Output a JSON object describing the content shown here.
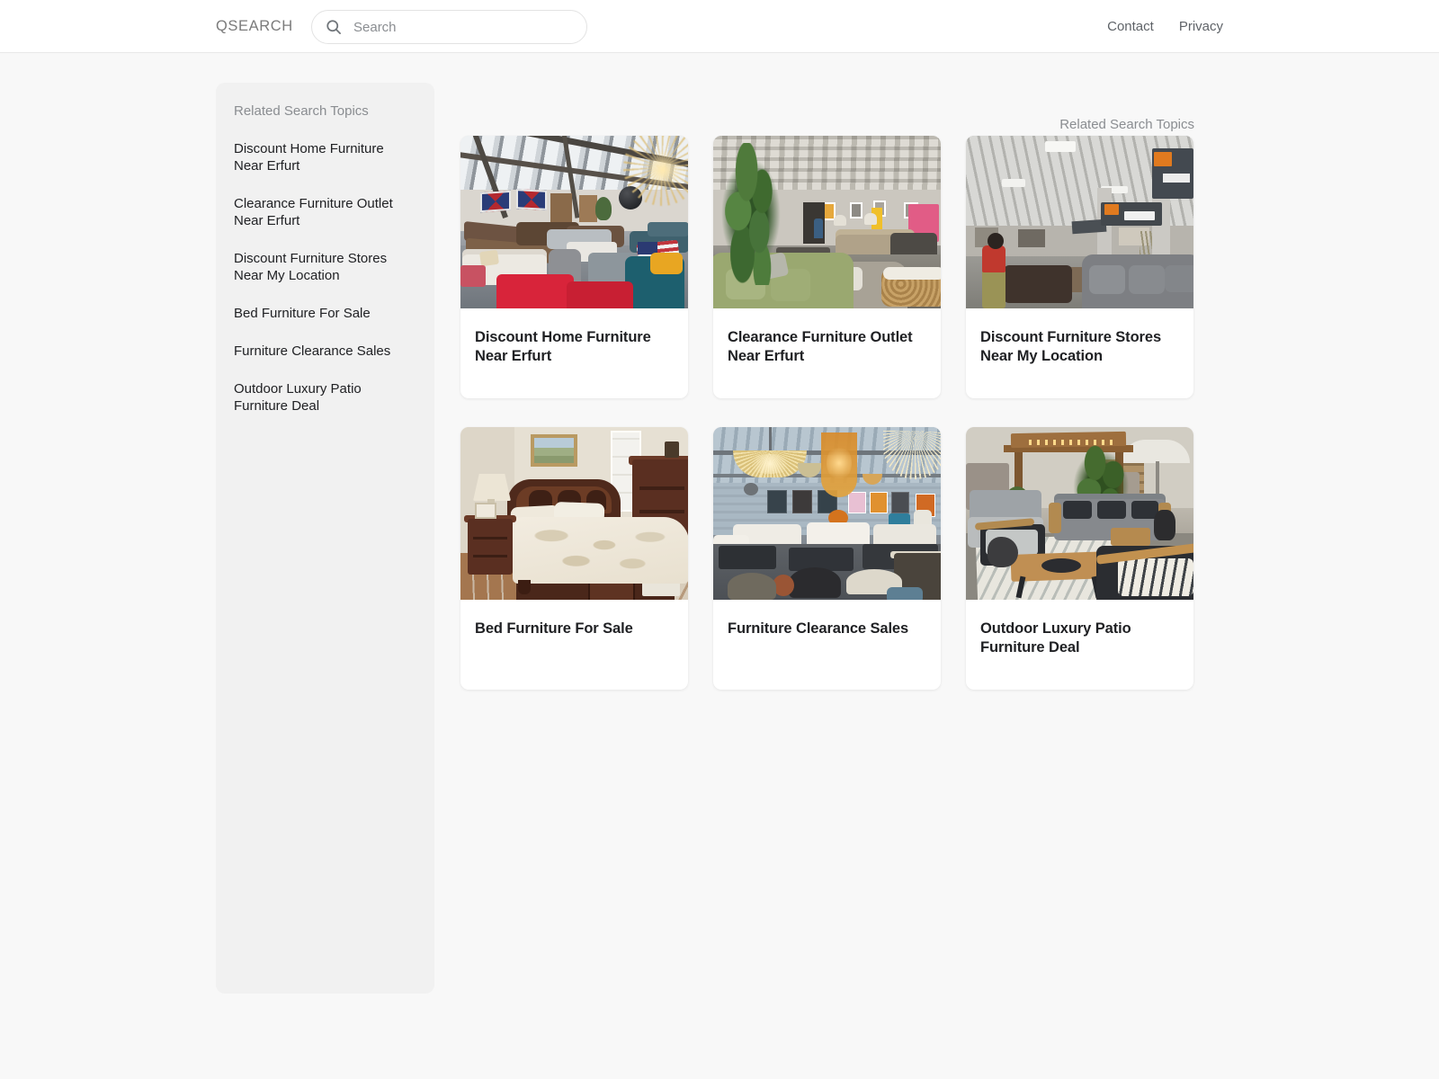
{
  "header": {
    "brand": "QSEARCH",
    "search": {
      "placeholder": "Search",
      "value": "",
      "icon": "search-icon"
    },
    "links": [
      {
        "label": "Contact"
      },
      {
        "label": "Privacy"
      }
    ]
  },
  "sidebar": {
    "heading": "Related Search Topics",
    "items": [
      {
        "label": "Discount Home Furniture Near Erfurt"
      },
      {
        "label": "Clearance Furniture Outlet Near Erfurt"
      },
      {
        "label": "Discount Furniture Stores Near My Location"
      },
      {
        "label": "Bed Furniture For Sale"
      },
      {
        "label": "Furniture Clearance Sales"
      },
      {
        "label": "Outdoor Luxury Patio Furniture Deal"
      }
    ]
  },
  "main": {
    "heading": "Related Search Topics",
    "cards": [
      {
        "title": "Discount Home Furniture Near Erfurt",
        "image": "furniture-warehouse-loft-photo"
      },
      {
        "title": "Clearance Furniture Outlet Near Erfurt",
        "image": "furniture-showroom-green-sofa-photo"
      },
      {
        "title": "Discount Furniture Stores Near My Location",
        "image": "big-box-furniture-store-photo"
      },
      {
        "title": "Bed Furniture For Sale",
        "image": "bedroom-cherry-sleigh-bed-photo"
      },
      {
        "title": "Furniture Clearance Sales",
        "image": "chandelier-showroom-photo"
      },
      {
        "title": "Outdoor Luxury Patio Furniture Deal",
        "image": "outdoor-patio-furniture-photo"
      }
    ]
  },
  "colors": {
    "page_background": "#f8f8f8",
    "header_background": "#ffffff",
    "sidebar_background": "#f1f1f1",
    "card_background": "#ffffff",
    "title_text": "#1f2023",
    "muted_text": "#8a8d91"
  }
}
